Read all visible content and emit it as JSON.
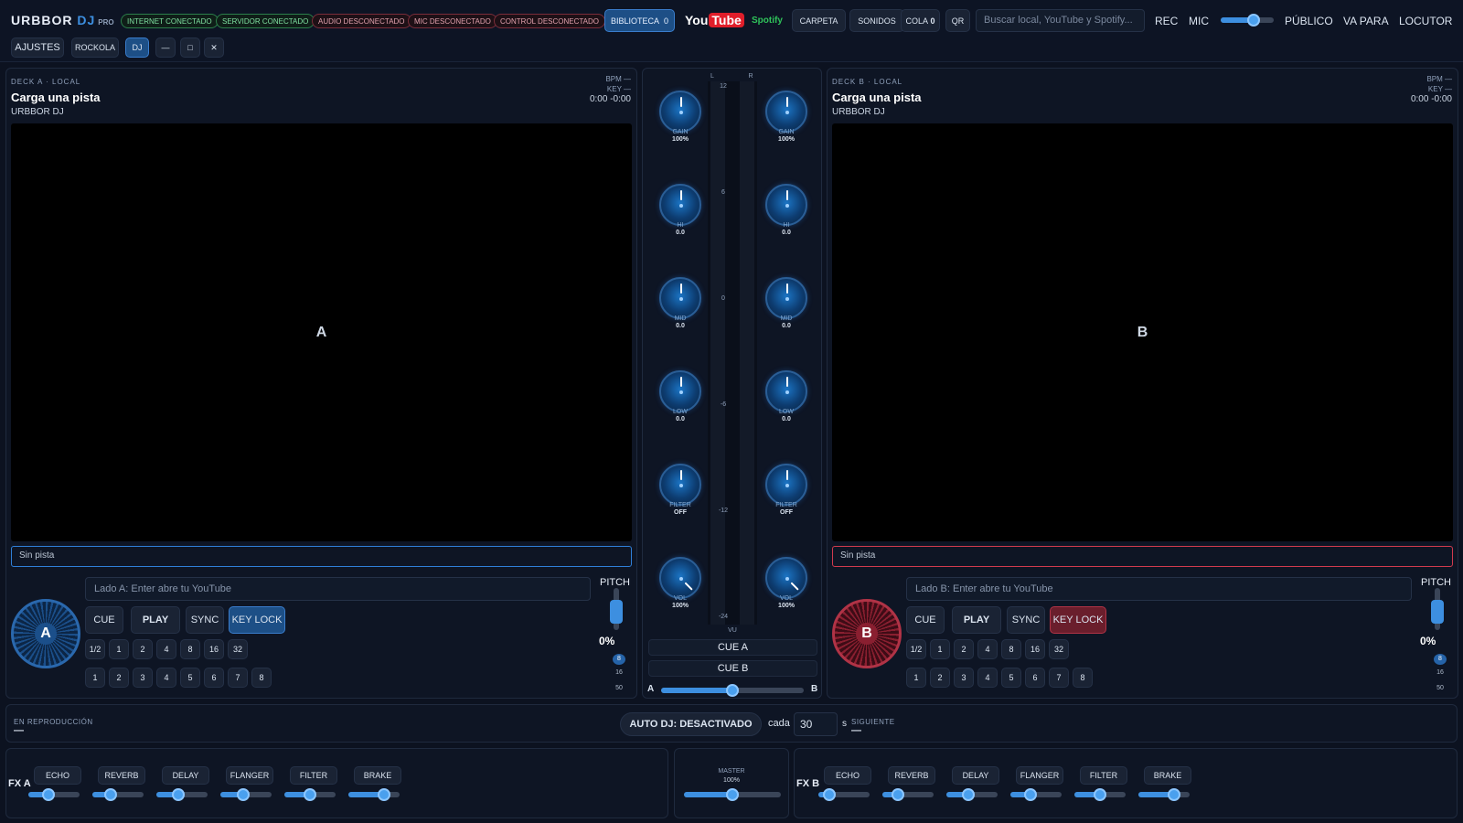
{
  "topbar": {
    "logo": {
      "main": "URBBOR",
      "dj": "DJ",
      "pro": "PRO"
    },
    "status": [
      {
        "label": "INTERNET CONECTADO",
        "state": "ok"
      },
      {
        "label": "SERVIDOR CONECTADO",
        "state": "ok"
      },
      {
        "label": "AUDIO DESCONECTADO",
        "state": "off"
      },
      {
        "label": "MIC DESCONECTADO",
        "state": "off"
      },
      {
        "label": "CONTROL DESCONECTADO",
        "state": "off"
      }
    ],
    "biblioteca": {
      "label": "BIBLIOTECA",
      "count": "0"
    },
    "youtube": {
      "you": "You",
      "tube": "Tube"
    },
    "spotify": "Spotify",
    "carpeta": "CARPETA",
    "sonidos": "SONIDOS",
    "cola": {
      "label": "COLA",
      "count": "0"
    },
    "qr": "QR",
    "search_placeholder": "Buscar local, YouTube y Spotify...",
    "rec": "REC",
    "mic": "MIC",
    "mic_level": 0.62,
    "publico": "PÚBLICO",
    "vapara": "VA PARA",
    "locutor": "LOCUTOR",
    "ajustes": "AJUSTES",
    "rockola": "ROCKOLA",
    "dj": "DJ",
    "min": "—",
    "max": "□",
    "close": "✕"
  },
  "deckA": {
    "label": "DECK A · LOCAL",
    "title": "Carga una pista",
    "sub": "URBBOR DJ",
    "bpm": "BPM —",
    "key": "KEY —",
    "time": "0:00   -0:00",
    "video_letter": "A",
    "track": "Sin pista",
    "platter": "A",
    "yt_placeholder": "Lado A: Enter abre tu YouTube",
    "cue": "CUE",
    "play": "PLAY",
    "sync": "SYNC",
    "keylock": "KEY LOCK",
    "loops": [
      "1/2",
      "1",
      "2",
      "4",
      "8",
      "16",
      "32"
    ],
    "hotcues": [
      "1",
      "2",
      "3",
      "4",
      "5",
      "6",
      "7",
      "8"
    ],
    "pitch_label": "PITCH",
    "pitch_value": "0%",
    "ranges": [
      "8",
      "16",
      "50"
    ],
    "accent": "#2f7fd8"
  },
  "deckB": {
    "label": "DECK B · LOCAL",
    "title": "Carga una pista",
    "sub": "URBBOR DJ",
    "bpm": "BPM —",
    "key": "KEY —",
    "time": "0:00   -0:00",
    "video_letter": "B",
    "track": "Sin pista",
    "platter": "B",
    "yt_placeholder": "Lado B: Enter abre tu YouTube",
    "cue": "CUE",
    "play": "PLAY",
    "sync": "SYNC",
    "keylock": "KEY LOCK",
    "loops": [
      "1/2",
      "1",
      "2",
      "4",
      "8",
      "16",
      "32"
    ],
    "hotcues": [
      "1",
      "2",
      "3",
      "4",
      "5",
      "6",
      "7",
      "8"
    ],
    "pitch_label": "PITCH",
    "pitch_value": "0%",
    "ranges": [
      "8",
      "16",
      "50"
    ],
    "accent": "#d03a4e"
  },
  "mixer": {
    "L": "L",
    "R": "R",
    "knobs": [
      {
        "label": "GAIN",
        "value": "100%"
      },
      {
        "label": "HI",
        "value": "0.0"
      },
      {
        "label": "MID",
        "value": "0.0"
      },
      {
        "label": "LOW",
        "value": "0.0"
      },
      {
        "label": "FILTER",
        "value": "OFF"
      },
      {
        "label": "VOL",
        "value": "100%"
      }
    ],
    "vu_scale": [
      "12",
      "6",
      "0",
      "-6",
      "-12",
      "-24"
    ],
    "vu": "VU",
    "cueA": "CUE A",
    "cueB": "CUE B",
    "xfA": "A",
    "xfB": "B",
    "crossfader": 0.5
  },
  "nowbar": {
    "playing_label": "EN REPRODUCCIÓN",
    "playing_value": "—",
    "autodj": "AUTO DJ: DESACTIVADO",
    "cada": "cada",
    "seconds": "30",
    "s": "s",
    "next_label": "SIGUIENTE",
    "next_value": "—"
  },
  "fxA": {
    "label": "FX A",
    "effects": [
      {
        "name": "ECHO",
        "level": 0.4
      },
      {
        "name": "REVERB",
        "level": 0.35
      },
      {
        "name": "DELAY",
        "level": 0.42
      },
      {
        "name": "FLANGER",
        "level": 0.45
      },
      {
        "name": "FILTER",
        "level": 0.5
      },
      {
        "name": "BRAKE",
        "level": 0.7
      }
    ]
  },
  "master": {
    "label": "MASTER",
    "value": "100%",
    "level": 0.5
  },
  "fxB": {
    "label": "FX B",
    "effects": [
      {
        "name": "ECHO",
        "level": 0.22
      },
      {
        "name": "REVERB",
        "level": 0.3
      },
      {
        "name": "DELAY",
        "level": 0.42
      },
      {
        "name": "FLANGER",
        "level": 0.4
      },
      {
        "name": "FILTER",
        "level": 0.5
      },
      {
        "name": "BRAKE",
        "level": 0.7
      }
    ]
  }
}
